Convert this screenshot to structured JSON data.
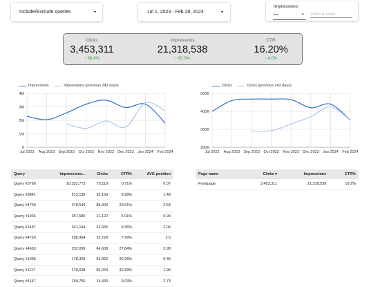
{
  "controls": {
    "filter_dropdown": {
      "value": "Include/Exclude queries",
      "arrow": "▾"
    },
    "date_dropdown": {
      "value": "Jul 1, 2023 - Feb 28, 2024",
      "arrow": "▾"
    },
    "impressions_filter": {
      "label": "Impressions",
      "operator": ">=",
      "arrow": "▾",
      "placeholder": "Enter a value"
    }
  },
  "scorecard": {
    "clicks": {
      "label": "Clicks",
      "value": "3,453,311",
      "delta": "↑ 68.8%"
    },
    "impressions": {
      "label": "Impressions",
      "value": "21,318,538",
      "delta": "↑ 62.3%"
    },
    "ctr": {
      "label": "CTR",
      "value": "16.20%",
      "delta": "↑ 4.0%"
    }
  },
  "colors": {
    "current_series": "#3f78c8",
    "previous_series": "#a9c4ea",
    "positive_delta": "#3a9a45"
  },
  "charts": {
    "impressions_chart": {
      "legend": {
        "current": "Impressions",
        "previous": "Impressions (previous 243 days)"
      }
    },
    "clicks_chart": {
      "legend": {
        "current": "Clicks",
        "previous": "Clicks (previous 243 days)"
      }
    }
  },
  "chart_data": [
    {
      "type": "line",
      "x_labels": [
        "Jul 2023",
        "Aug 2023",
        "Sep 2023",
        "Oct 2023",
        "Nov 2023",
        "Dec 2023",
        "Jan 2024",
        "Feb 2024"
      ],
      "y_ticks": [
        "0",
        "1M",
        "2M",
        "3M",
        "4M"
      ],
      "ylim": [
        0,
        4000000
      ],
      "grid": true,
      "legend_position": "top-left",
      "series": [
        {
          "name": "Impressions",
          "x": [
            0,
            1,
            2,
            3,
            4,
            5,
            6,
            7
          ],
          "values": [
            2300000,
            2050000,
            2550000,
            3200000,
            3500000,
            2950000,
            3200000,
            1800000
          ]
        },
        {
          "name": "Impressions (previous 243 days)",
          "x": [
            2,
            3,
            4,
            5,
            6,
            7
          ],
          "values": [
            1750000,
            1400000,
            1950000,
            1500000,
            3300000,
            2700000
          ]
        }
      ]
    },
    {
      "type": "line",
      "x_labels": [
        "Jul 2023",
        "Aug 2023",
        "Sep 2023",
        "Oct 2023",
        "Nov 2023",
        "Dec 2023",
        "Jan 2024",
        "Feb 2024"
      ],
      "y_ticks": [
        "200K",
        "300K",
        "400K",
        "500K"
      ],
      "ylim": [
        200000,
        500000
      ],
      "grid": true,
      "legend_position": "top-left",
      "series": [
        {
          "name": "Clicks",
          "x": [
            0,
            1,
            2,
            3,
            4,
            5,
            6,
            7
          ],
          "values": [
            400000,
            460000,
            468000,
            468000,
            465000,
            420000,
            440000,
            350000
          ]
        },
        {
          "name": "Clicks (previous 243 days)",
          "x": [
            2,
            3,
            4,
            5,
            6,
            7
          ],
          "values": [
            290000,
            292000,
            330000,
            370000,
            425000,
            350000
          ]
        }
      ]
    }
  ],
  "query_table": {
    "headers": [
      "Query",
      "Impressions...",
      "Clicks",
      "CTR%",
      "AVG position"
    ],
    "rows": [
      [
        "Query #5790",
        "10,322,773",
        "73,119",
        "0.71%",
        "0.07"
      ],
      [
        "Query #3841",
        "512,130",
        "32,169",
        "6.28%",
        "1.49"
      ],
      [
        "Query #4700",
        "378,544",
        "89,000",
        "23.51%",
        "2.54"
      ],
      [
        "Query #1936",
        "357,580",
        "21,122",
        "5.91%",
        "0.99"
      ],
      [
        "Query #1487",
        "341,164",
        "31,935",
        "9.36%",
        "2.06"
      ],
      [
        "Query #4750",
        "296,964",
        "23,728",
        "7.99%",
        "2.5"
      ],
      [
        "Query #4663",
        "232,099",
        "64,608",
        "27.84%",
        "3.98"
      ],
      [
        "Query #1095",
        "178,326",
        "53,952",
        "30.25%",
        "9.45"
      ],
      [
        "Query #1117",
        "170,608",
        "55,263",
        "32.39%",
        "1.95"
      ],
      [
        "Query #4147",
        "159,750",
        "14,433",
        "9.03%",
        "2.73"
      ]
    ]
  },
  "page_table": {
    "headers": [
      "Page name",
      "Clicks ▾",
      "Impressions",
      "CTR%"
    ],
    "rows": [
      [
        "Frontpage",
        "3,453,311",
        "21,318,538",
        "16.2%"
      ]
    ]
  }
}
